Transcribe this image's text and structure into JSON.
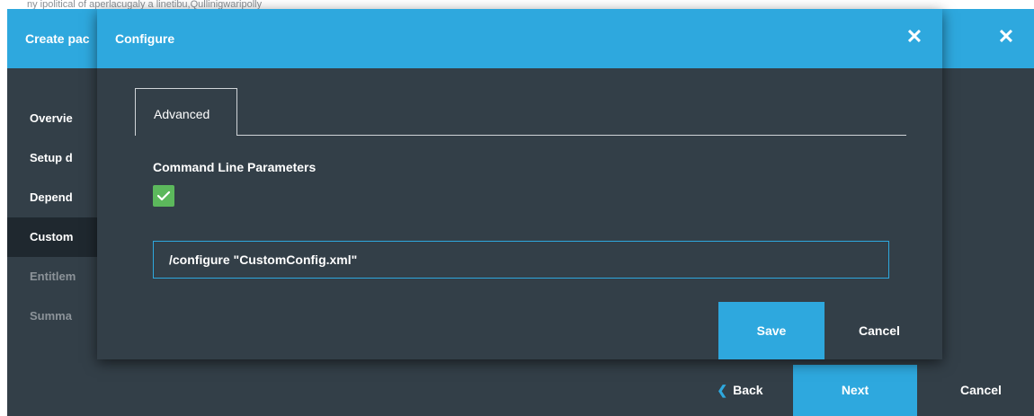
{
  "background": {
    "strip_text": "ny ipolitical of aperlacugaly a linetibu,Qullinigwaripolly"
  },
  "outer_dialog": {
    "title": "Create pac",
    "close_glyph": "✕",
    "steps": [
      {
        "label": "Overvie",
        "state": "normal"
      },
      {
        "label": "Setup d",
        "state": "normal"
      },
      {
        "label": "Depend",
        "state": "normal"
      },
      {
        "label": "Custom",
        "state": "active"
      },
      {
        "label": "Entitlem",
        "state": "disabled"
      },
      {
        "label": "Summa",
        "state": "disabled"
      }
    ],
    "back_label": "Back",
    "back_icon": "chevron-left-icon",
    "next_label": "Next",
    "cancel_label": "Cancel"
  },
  "modal": {
    "title": "Configure",
    "close_glyph": "✕",
    "tab_label": "Advanced",
    "section_title": "Command Line Parameters",
    "checkbox_checked": true,
    "command_value": "/configure \"CustomConfig.xml\"",
    "save_label": "Save",
    "cancel_label": "Cancel"
  },
  "colors": {
    "accent": "#2ea8de",
    "panel": "#333f48",
    "active_step": "#1f282f",
    "checkbox": "#5cb85c"
  }
}
